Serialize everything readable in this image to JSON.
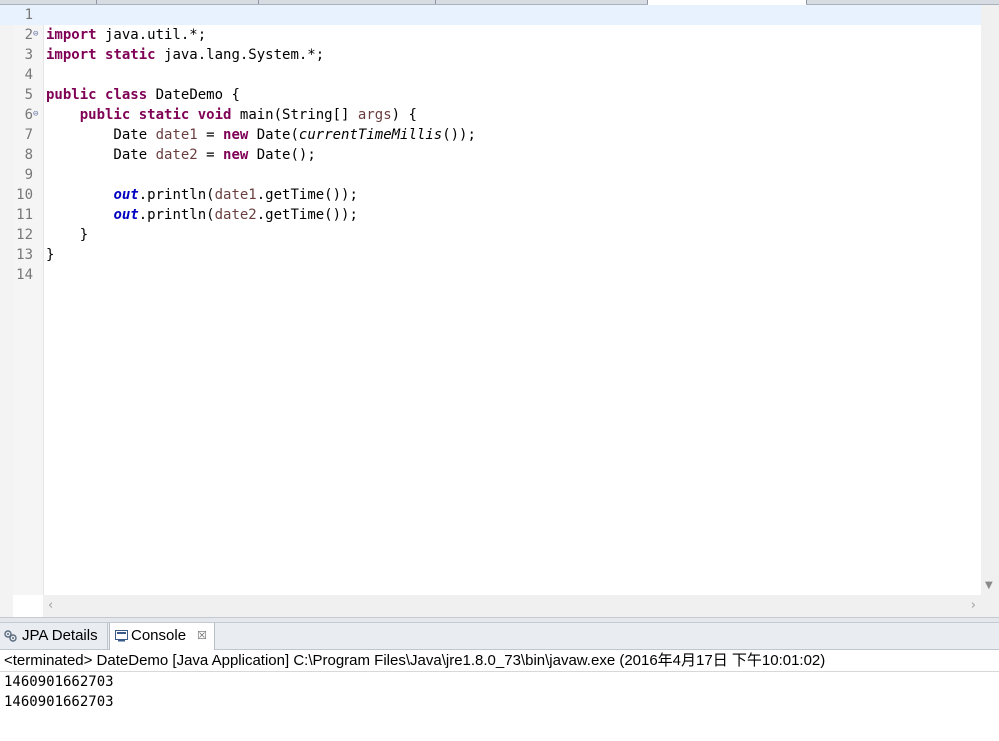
{
  "editor": {
    "lines": [
      {
        "n": "1",
        "fold": false,
        "current": true,
        "tokens": []
      },
      {
        "n": "2",
        "fold": true,
        "tokens": [
          {
            "t": "import",
            "c": "kw"
          },
          {
            "t": " java.util.*;"
          }
        ]
      },
      {
        "n": "3",
        "fold": false,
        "tokens": [
          {
            "t": "import",
            "c": "kw"
          },
          {
            "t": " "
          },
          {
            "t": "static",
            "c": "kw"
          },
          {
            "t": " java.lang.System.*;"
          }
        ]
      },
      {
        "n": "4",
        "fold": false,
        "tokens": []
      },
      {
        "n": "5",
        "fold": false,
        "tokens": [
          {
            "t": "public",
            "c": "kw"
          },
          {
            "t": " "
          },
          {
            "t": "class",
            "c": "kw"
          },
          {
            "t": " DateDemo {"
          }
        ]
      },
      {
        "n": "6",
        "fold": true,
        "tokens": [
          {
            "t": "    "
          },
          {
            "t": "public",
            "c": "kw"
          },
          {
            "t": " "
          },
          {
            "t": "static",
            "c": "kw"
          },
          {
            "t": " "
          },
          {
            "t": "void",
            "c": "kw"
          },
          {
            "t": " main(String[] "
          },
          {
            "t": "args",
            "c": "var"
          },
          {
            "t": ") {"
          }
        ]
      },
      {
        "n": "7",
        "fold": false,
        "tokens": [
          {
            "t": "        Date "
          },
          {
            "t": "date1",
            "c": "var"
          },
          {
            "t": " = "
          },
          {
            "t": "new",
            "c": "kw"
          },
          {
            "t": " Date("
          },
          {
            "t": "currentTimeMillis",
            "c": "sm"
          },
          {
            "t": "());"
          }
        ]
      },
      {
        "n": "8",
        "fold": false,
        "tokens": [
          {
            "t": "        Date "
          },
          {
            "t": "date2",
            "c": "var"
          },
          {
            "t": " = "
          },
          {
            "t": "new",
            "c": "kw"
          },
          {
            "t": " Date();"
          }
        ]
      },
      {
        "n": "9",
        "fold": false,
        "tokens": []
      },
      {
        "n": "10",
        "fold": false,
        "tokens": [
          {
            "t": "        "
          },
          {
            "t": "out",
            "c": "fld"
          },
          {
            "t": ".println("
          },
          {
            "t": "date1",
            "c": "var"
          },
          {
            "t": ".getTime());"
          }
        ]
      },
      {
        "n": "11",
        "fold": false,
        "tokens": [
          {
            "t": "        "
          },
          {
            "t": "out",
            "c": "fld"
          },
          {
            "t": ".println("
          },
          {
            "t": "date2",
            "c": "var"
          },
          {
            "t": ".getTime());"
          }
        ]
      },
      {
        "n": "12",
        "fold": false,
        "tokens": [
          {
            "t": "    }"
          }
        ]
      },
      {
        "n": "13",
        "fold": false,
        "tokens": [
          {
            "t": "}"
          }
        ]
      },
      {
        "n": "14",
        "fold": false,
        "tokens": []
      }
    ]
  },
  "panel": {
    "tabs": {
      "jpa_label": "JPA Details",
      "console_label": "Console",
      "close_glyph": "☒"
    },
    "status": "<terminated> DateDemo [Java Application] C:\\Program Files\\Java\\jre1.8.0_73\\bin\\javaw.exe (2016年4月17日 下午10:01:02)",
    "output": [
      "1460901662703",
      "1460901662703"
    ]
  },
  "icons": {
    "fold": "minus-circle-icon",
    "jpa": "jpa-details-icon",
    "console": "console-icon",
    "close": "close-icon"
  }
}
